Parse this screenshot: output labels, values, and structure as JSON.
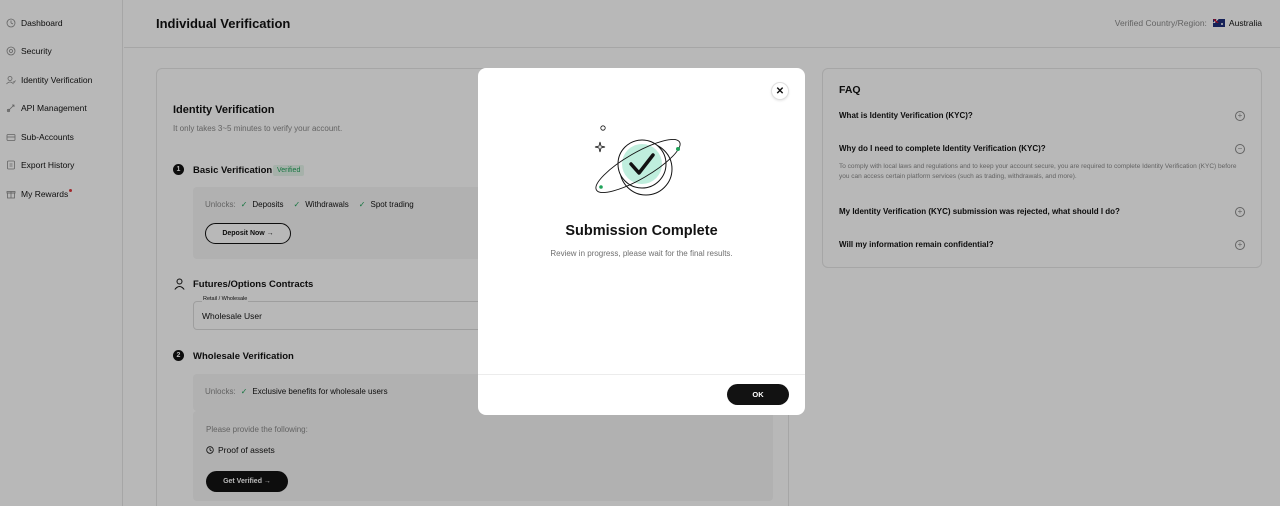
{
  "sidebar": {
    "items": [
      {
        "label": "Dashboard",
        "icon": "dashboard-icon"
      },
      {
        "label": "Security",
        "icon": "shield-icon"
      },
      {
        "label": "Identity Verification",
        "icon": "user-icon"
      },
      {
        "label": "API Management",
        "icon": "api-icon"
      },
      {
        "label": "Sub-Accounts",
        "icon": "sub-accounts-icon"
      },
      {
        "label": "Export History",
        "icon": "export-icon"
      },
      {
        "label": "My Rewards",
        "icon": "gift-icon"
      }
    ]
  },
  "header": {
    "title": "Individual Verification",
    "region_label": "Verified Country/Region:",
    "region_value": "Australia"
  },
  "main": {
    "title": "Identity Verification",
    "subtitle": "It only takes 3~5 minutes to verify your account.",
    "basic": {
      "step": "1",
      "title": "Basic Verification",
      "badge": "Verified",
      "unlocks_label": "Unlocks:",
      "unlocks": [
        "Deposits",
        "Withdrawals",
        "Spot trading"
      ],
      "button": "Deposit Now →"
    },
    "futures": {
      "title": "Futures/Options Contracts",
      "field_label": "Retail / Wholesale",
      "field_value": "Wholesale User"
    },
    "wholesale": {
      "step": "2",
      "title": "Wholesale Verification",
      "unlocks_label": "Unlocks:",
      "unlocks": [
        "Exclusive benefits for wholesale users"
      ],
      "provide_label": "Please provide the following:",
      "proof": "Proof of assets",
      "button": "Get Verified →"
    }
  },
  "faq": {
    "title": "FAQ",
    "items": [
      {
        "q": "What is Identity Verification (KYC)?",
        "state": "collapsed"
      },
      {
        "q": "Why do I need to complete Identity Verification (KYC)?",
        "state": "expanded",
        "a": "To comply with local laws and regulations and to keep your account secure, you are required to complete Identity Verification (KYC) before you can access certain platform services (such as trading, withdrawals, and more)."
      },
      {
        "q": "My Identity Verification (KYC) submission was rejected, what should I do?",
        "state": "collapsed"
      },
      {
        "q": "Will my information remain confidential?",
        "state": "collapsed"
      }
    ]
  },
  "modal": {
    "title": "Submission Complete",
    "subtitle": "Review in progress, please wait for the final results.",
    "ok": "OK",
    "close_icon": "close-icon"
  },
  "colors": {
    "accent_green": "#20a35a",
    "dark": "#121212",
    "mint": "#bfeedd",
    "overlay": "rgba(0,0,0,0.28)"
  }
}
